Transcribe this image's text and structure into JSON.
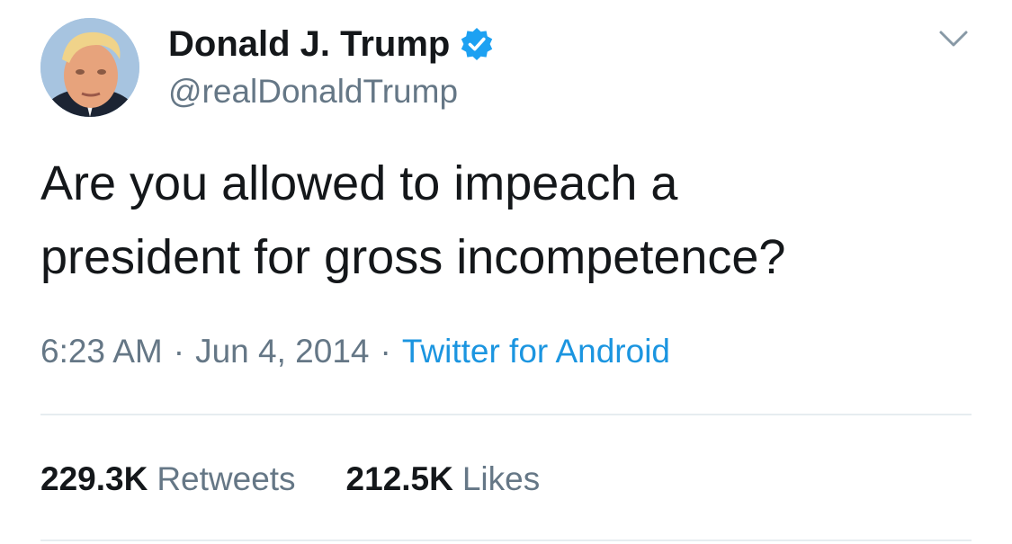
{
  "tweet": {
    "author": {
      "display_name": "Donald J. Trump",
      "handle": "@realDonaldTrump",
      "verified": true,
      "avatar_icon": "profile-photo"
    },
    "text": "Are you allowed to impeach a\npresident for gross incompetence?",
    "time": "6:23 AM",
    "date": "Jun 4, 2014",
    "source": "Twitter for Android",
    "separator": "·",
    "stats": {
      "retweets_count": "229.3K",
      "retweets_label": "Retweets",
      "likes_count": "212.5K",
      "likes_label": "Likes"
    }
  },
  "colors": {
    "text_primary": "#14171a",
    "text_secondary": "#657786",
    "link": "#1b95e0",
    "verified_badge": "#1da1f2",
    "divider": "#e6ecf0"
  },
  "icons": {
    "verified": "verified-badge-icon",
    "menu": "chevron-down-icon"
  }
}
